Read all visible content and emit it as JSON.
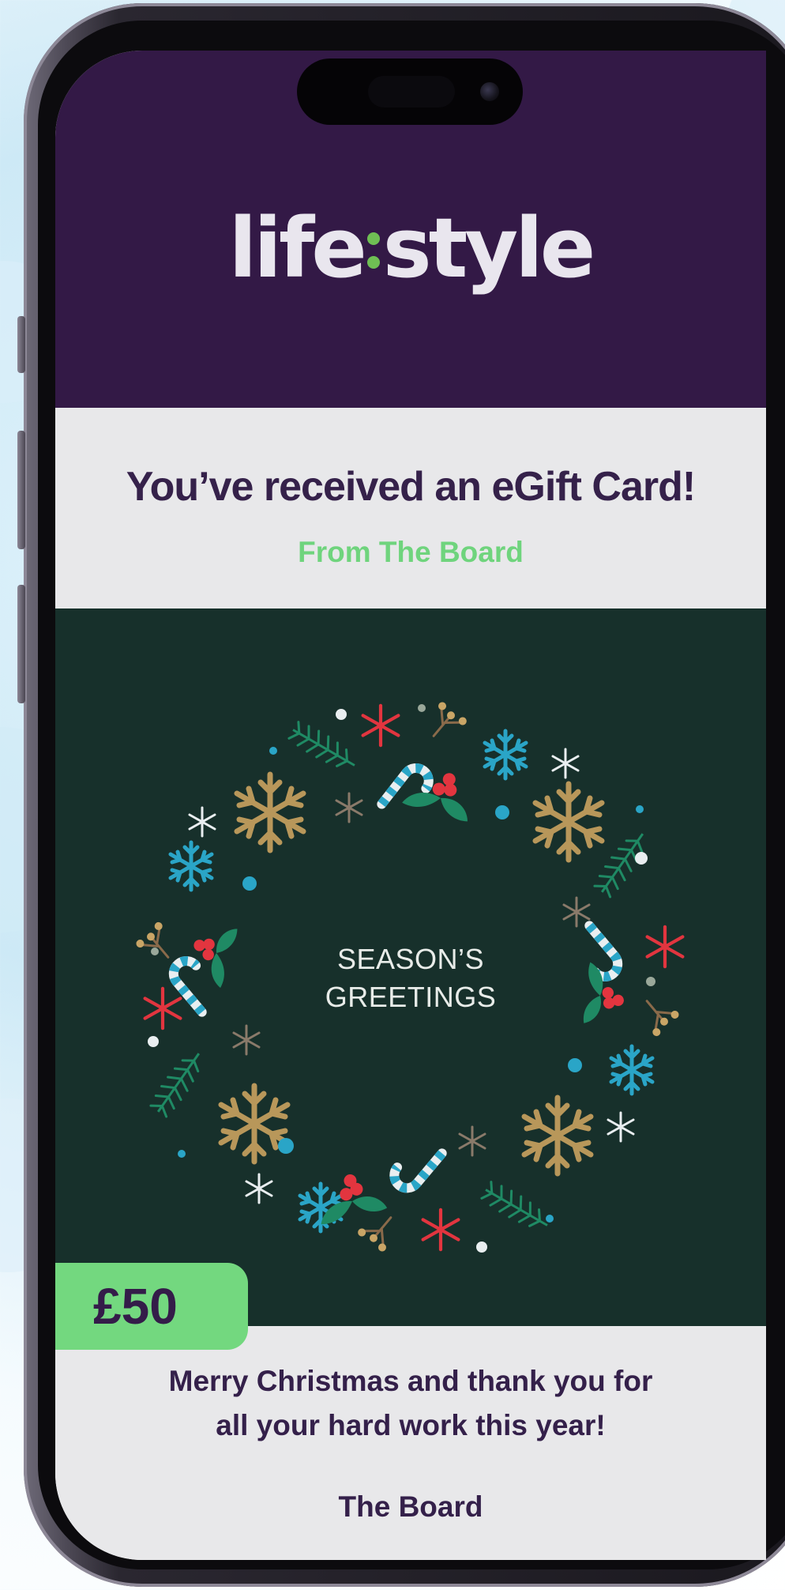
{
  "brand": {
    "logo_left": "life",
    "logo_right": "style"
  },
  "intro": {
    "title": "You’ve received an eGift Card!",
    "from": "From The Board"
  },
  "card": {
    "greeting_line1": "SEASON’S",
    "greeting_line2": "GREETINGS",
    "amount": "£50"
  },
  "message": {
    "line1": "Merry Christmas and thank you for",
    "line2": "all your hard work this year!",
    "signature": "The Board"
  },
  "colors": {
    "header_bg": "#331946",
    "accent_green": "#6fd47d",
    "card_bg": "#17302b",
    "text_purple": "#34204a",
    "gold": "#b8975a",
    "cyan": "#2aa5c7",
    "red": "#e2353f",
    "leaf_green": "#1f8a64"
  },
  "icons": [
    "snowflake-icon",
    "candy-cane-icon",
    "holly-icon",
    "pine-branch-icon",
    "berry-sprig-icon",
    "star-sparkle-icon"
  ]
}
